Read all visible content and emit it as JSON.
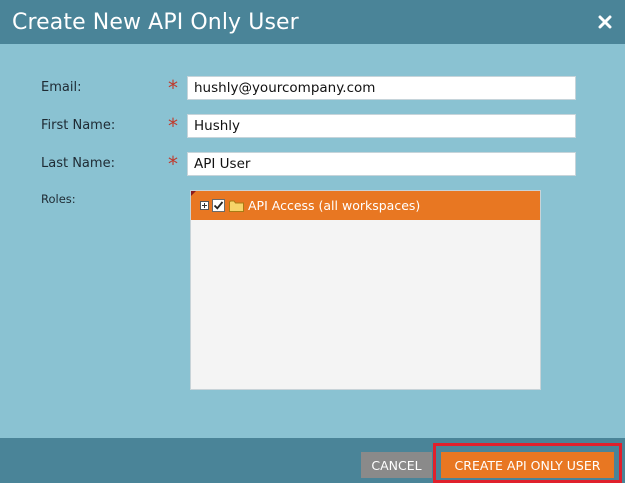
{
  "dialog": {
    "title": "Create New API Only User",
    "close_icon": "close-x-icon"
  },
  "form": {
    "email": {
      "label": "Email:",
      "value": "hushly@yourcompany.com",
      "required": "*"
    },
    "first_name": {
      "label": "First Name:",
      "value": "Hushly",
      "required": "*"
    },
    "last_name": {
      "label": "Last Name:",
      "value": "API User",
      "required": "*"
    },
    "roles": {
      "label": "Roles:",
      "items": [
        {
          "label": "API Access (all workspaces)",
          "checked": true,
          "expander_icon": "plus-expander-icon",
          "folder_icon": "folder-icon"
        }
      ]
    }
  },
  "footer": {
    "cancel_label": "CANCEL",
    "create_label": "CREATE API ONLY USER"
  },
  "colors": {
    "title_bar": "#4a8498",
    "body": "#8ac2d2",
    "accent": "#e87722",
    "cancel": "#8a8a8a",
    "highlight": "#e0202c"
  }
}
